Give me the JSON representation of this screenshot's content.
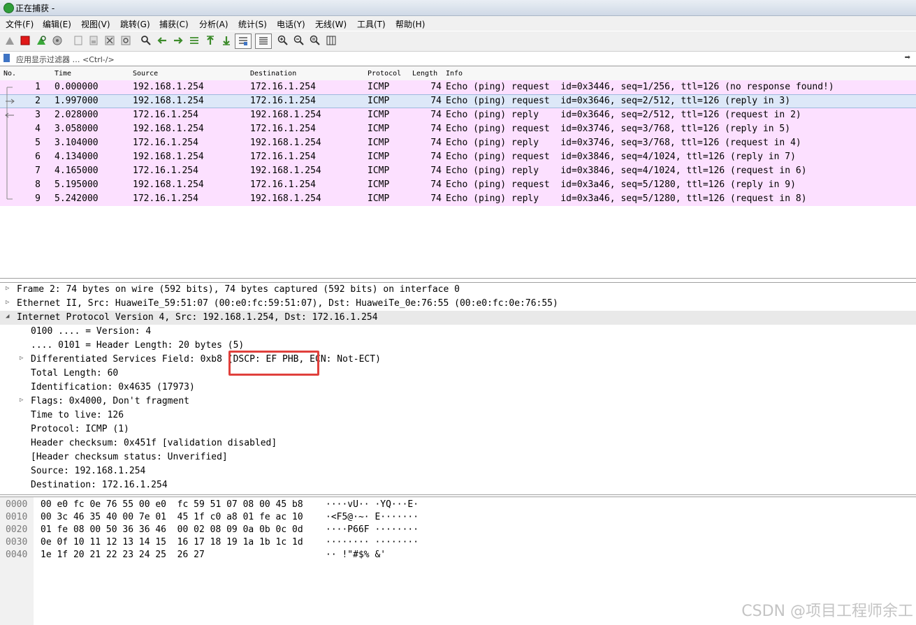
{
  "window": {
    "title": "正在捕获 -"
  },
  "menu": [
    "文件(F)",
    "编辑(E)",
    "视图(V)",
    "跳转(G)",
    "捕获(C)",
    "分析(A)",
    "统计(S)",
    "电话(Y)",
    "无线(W)",
    "工具(T)",
    "帮助(H)"
  ],
  "toolbar": {
    "icons": [
      "shark-fin-start-icon",
      "stop-capture-icon",
      "restart-capture-icon",
      "capture-options-icon",
      "open-file-icon",
      "save-file-icon",
      "close-file-icon",
      "reload-file-icon",
      "find-packet-icon",
      "go-back-icon",
      "go-forward-icon",
      "go-to-packet-icon",
      "first-packet-icon",
      "last-packet-icon",
      "auto-scroll-icon",
      "colorize-icon",
      "zoom-in-icon",
      "zoom-out-icon",
      "normal-size-icon",
      "resize-columns-icon"
    ]
  },
  "filter": {
    "placeholder": "应用显示过滤器 … <Ctrl-/>",
    "arrow": "➡"
  },
  "packet_list": {
    "columns": [
      "No.",
      "Time",
      "Source",
      "Destination",
      "Protocol",
      "Length",
      "Info"
    ],
    "rows": [
      {
        "no": "1",
        "time": "0.000000",
        "src": "192.168.1.254",
        "dst": "172.16.1.254",
        "proto": "ICMP",
        "len": "74",
        "info": "Echo (ping) request  id=0x3446, seq=1/256, ttl=126 (no response found!)"
      },
      {
        "no": "2",
        "time": "1.997000",
        "src": "192.168.1.254",
        "dst": "172.16.1.254",
        "proto": "ICMP",
        "len": "74",
        "info": "Echo (ping) request  id=0x3646, seq=2/512, ttl=126 (reply in 3)"
      },
      {
        "no": "3",
        "time": "2.028000",
        "src": "172.16.1.254",
        "dst": "192.168.1.254",
        "proto": "ICMP",
        "len": "74",
        "info": "Echo (ping) reply    id=0x3646, seq=2/512, ttl=126 (request in 2)"
      },
      {
        "no": "4",
        "time": "3.058000",
        "src": "192.168.1.254",
        "dst": "172.16.1.254",
        "proto": "ICMP",
        "len": "74",
        "info": "Echo (ping) request  id=0x3746, seq=3/768, ttl=126 (reply in 5)"
      },
      {
        "no": "5",
        "time": "3.104000",
        "src": "172.16.1.254",
        "dst": "192.168.1.254",
        "proto": "ICMP",
        "len": "74",
        "info": "Echo (ping) reply    id=0x3746, seq=3/768, ttl=126 (request in 4)"
      },
      {
        "no": "6",
        "time": "4.134000",
        "src": "192.168.1.254",
        "dst": "172.16.1.254",
        "proto": "ICMP",
        "len": "74",
        "info": "Echo (ping) request  id=0x3846, seq=4/1024, ttl=126 (reply in 7)"
      },
      {
        "no": "7",
        "time": "4.165000",
        "src": "172.16.1.254",
        "dst": "192.168.1.254",
        "proto": "ICMP",
        "len": "74",
        "info": "Echo (ping) reply    id=0x3846, seq=4/1024, ttl=126 (request in 6)"
      },
      {
        "no": "8",
        "time": "5.195000",
        "src": "192.168.1.254",
        "dst": "172.16.1.254",
        "proto": "ICMP",
        "len": "74",
        "info": "Echo (ping) request  id=0x3a46, seq=5/1280, ttl=126 (reply in 9)"
      },
      {
        "no": "9",
        "time": "5.242000",
        "src": "172.16.1.254",
        "dst": "192.168.1.254",
        "proto": "ICMP",
        "len": "74",
        "info": "Echo (ping) reply    id=0x3a46, seq=5/1280, ttl=126 (request in 8)"
      }
    ],
    "selected_row": 2
  },
  "details": [
    {
      "text": "Frame 2: 74 bytes on wire (592 bits), 74 bytes captured (592 bits) on interface 0",
      "level": 0,
      "toggle": "▷",
      "highlight": false
    },
    {
      "text": "Ethernet II, Src: HuaweiTe_59:51:07 (00:e0:fc:59:51:07), Dst: HuaweiTe_0e:76:55 (00:e0:fc:0e:76:55)",
      "level": 0,
      "toggle": "▷",
      "highlight": false
    },
    {
      "text": "Internet Protocol Version 4, Src: 192.168.1.254, Dst: 172.16.1.254",
      "level": 0,
      "toggle": "◢",
      "highlight": true
    },
    {
      "text": "0100 .... = Version: 4",
      "level": 1,
      "toggle": "",
      "highlight": false
    },
    {
      "text": ".... 0101 = Header Length: 20 bytes (5)",
      "level": 1,
      "toggle": "",
      "highlight": false
    },
    {
      "text": "Differentiated Services Field: 0xb8 (DSCP: EF PHB, ECN: Not-ECT)",
      "level": 1,
      "toggle": "▷",
      "highlight": false
    },
    {
      "text": "Total Length: 60",
      "level": 1,
      "toggle": "",
      "highlight": false
    },
    {
      "text": "Identification: 0x4635 (17973)",
      "level": 1,
      "toggle": "",
      "highlight": false
    },
    {
      "text": "Flags: 0x4000, Don't fragment",
      "level": 1,
      "toggle": "▷",
      "highlight": false
    },
    {
      "text": "Time to live: 126",
      "level": 1,
      "toggle": "",
      "highlight": false
    },
    {
      "text": "Protocol: ICMP (1)",
      "level": 1,
      "toggle": "",
      "highlight": false
    },
    {
      "text": "Header checksum: 0x451f [validation disabled]",
      "level": 1,
      "toggle": "",
      "highlight": false
    },
    {
      "text": "[Header checksum status: Unverified]",
      "level": 1,
      "toggle": "",
      "highlight": false
    },
    {
      "text": "Source: 192.168.1.254",
      "level": 1,
      "toggle": "",
      "highlight": false
    },
    {
      "text": "Destination: 172.16.1.254",
      "level": 1,
      "toggle": "",
      "highlight": false
    }
  ],
  "bytes": [
    {
      "offset": "0000",
      "hex": "00 e0 fc 0e 76 55 00 e0  fc 59 51 07 08 00 45 b8",
      "ascii": "····vU·· ·YQ···E·"
    },
    {
      "offset": "0010",
      "hex": "00 3c 46 35 40 00 7e 01  45 1f c0 a8 01 fe ac 10",
      "ascii": "·<F5@·~· E·······"
    },
    {
      "offset": "0020",
      "hex": "01 fe 08 00 50 36 36 46  00 02 08 09 0a 0b 0c 0d",
      "ascii": "····P66F ········"
    },
    {
      "offset": "0030",
      "hex": "0e 0f 10 11 12 13 14 15  16 17 18 19 1a 1b 1c 1d",
      "ascii": "········ ········"
    },
    {
      "offset": "0040",
      "hex": "1e 1f 20 21 22 23 24 25  26 27",
      "ascii": "·· !\"#$% &'"
    }
  ],
  "colors": {
    "row_pink": "#fce0ff",
    "row_selected": "#dde8f8",
    "annotation_red": "#e0403c"
  },
  "watermark": "CSDN @项目工程师余工"
}
